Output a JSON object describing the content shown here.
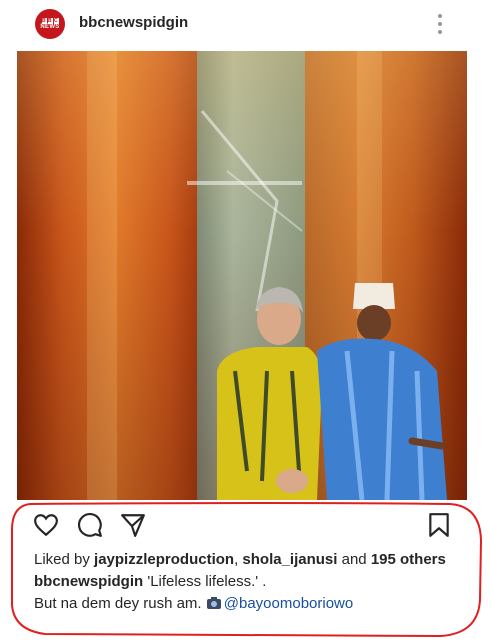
{
  "post": {
    "username": "bbcnewspidgin",
    "avatar_text_top": "BBC",
    "avatar_text_bottom": "NEWS",
    "accent_color": "#c4161c"
  },
  "likes": {
    "prefix": "Liked by ",
    "user1": "jaypizzleproduction",
    "separator": ", ",
    "user2": "shola_ijanusi",
    "middle": " and ",
    "others": "195 others"
  },
  "caption": {
    "username": "bbcnewspidgin",
    "text": " 'Lifeless lifeless.' .",
    "line2": "But na dem dey rush am. ",
    "mention": "@bayoomoboriowo"
  },
  "icons": {
    "like": "heart-icon",
    "comment": "comment-icon",
    "share": "send-icon",
    "save": "bookmark-icon",
    "more": "more-vertical-icon"
  },
  "annotation_color": "#e02020"
}
